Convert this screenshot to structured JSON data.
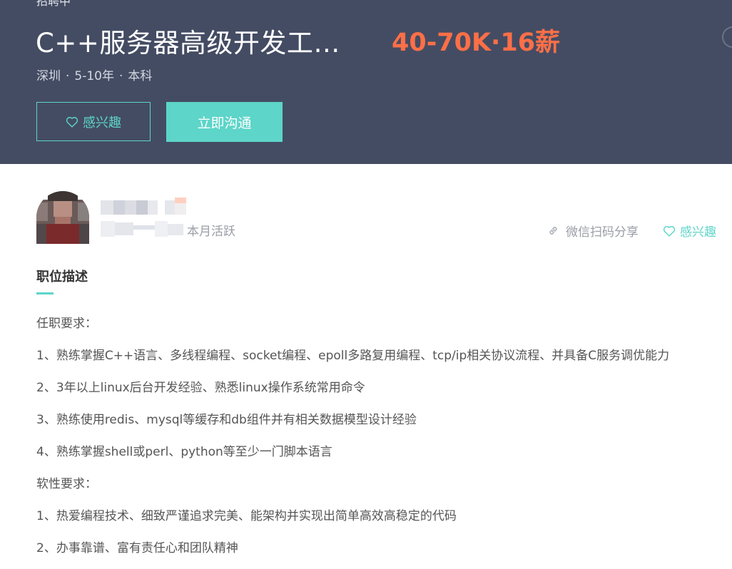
{
  "job": {
    "status": "招聘中",
    "title": "C++服务器高级开发工…",
    "salary": "40-70K·16薪",
    "city": "深圳",
    "experience": "5-10年",
    "education": "本科",
    "separator": "·"
  },
  "actions": {
    "interest_label": "感兴趣",
    "chat_label": "立即沟通"
  },
  "recruiter": {
    "activity": "本月活跃"
  },
  "toolbar": {
    "share_label": "微信扫码分享",
    "interest_label": "感兴趣"
  },
  "description": {
    "title": "职位描述",
    "lines": [
      "任职要求：",
      "1、熟练掌握C++语言、多线程编程、socket编程、epoll多路复用编程、tcp/ip相关协议流程、并具备C服务调优能力",
      "2、3年以上linux后台开发经验、熟悉linux操作系统常用命令",
      "3、熟练使用redis、mysql等缓存和db组件并有相关数据模型设计经验",
      "4、熟练掌握shell或perl、python等至少一门脚本语言",
      "软性要求：",
      "1、热爱编程技术、细致严谨追求完美、能架构并实现出简单高效高稳定的代码",
      "2、办事靠谱、富有责任心和团队精神"
    ]
  },
  "colors": {
    "header_bg": "#444c63",
    "accent": "#5dd5c8",
    "salary": "#fd6f47"
  },
  "icons": [
    "heart-icon",
    "link-icon"
  ]
}
